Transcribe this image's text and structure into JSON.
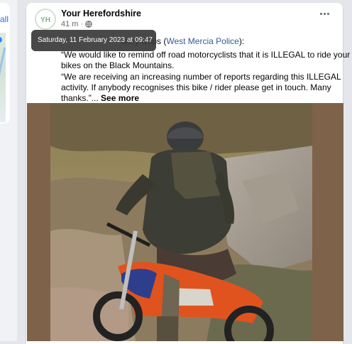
{
  "left": {
    "see_all": "all"
  },
  "post": {
    "page_name": "Your Herefordshire",
    "time": "41 m",
    "meta_separator": "·",
    "avatar_initials": "YH",
    "tooltip": "Saturday, 11 February 2023 at 09:47",
    "line1_tail": "alley Cops (",
    "line1_link": "West Mercia Police",
    "line1_end": "):",
    "para1": "“We would like to remind off road motorcyclists that it is ILLEGAL to ride your bikes on the Black Mountains.",
    "para2": "“We are receiving an increasing number of reports regarding this ILLEGAL activity. If anybody recognises this bike / rider please get in touch.  Many thanks.”...",
    "see_more": "See more"
  },
  "icons": {
    "more": "more-options-icon",
    "globe": "globe-icon",
    "photo": "post-photo"
  },
  "colors": {
    "link": "#385898",
    "accent": "#1b74e4",
    "tooltip_bg": "#383838",
    "media_bg": "#7e6249"
  }
}
